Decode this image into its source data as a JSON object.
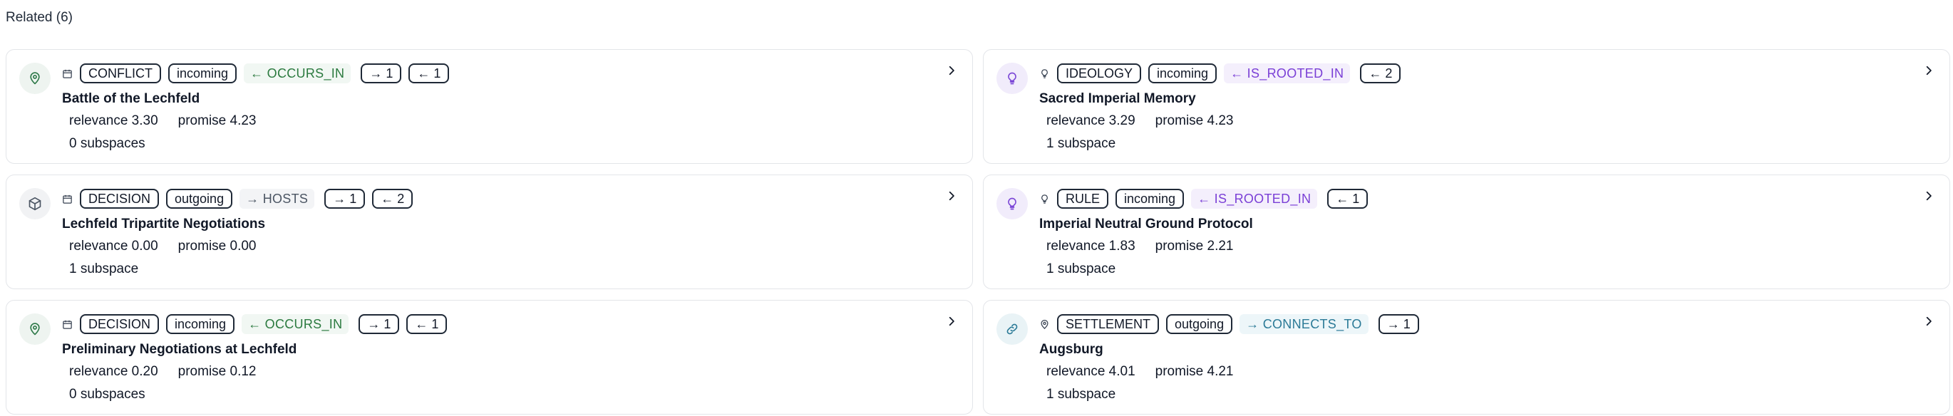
{
  "section": {
    "title": "Related (6)"
  },
  "cards": [
    {
      "avatar_icon": "map-pin-icon",
      "type_icon": "calendar-icon",
      "type": "CONFLICT",
      "direction": "incoming",
      "relation": "← OCCURS_IN",
      "relation_color": "green",
      "counts": [
        "→ 1",
        "← 1"
      ],
      "title": "Battle of the Lechfeld",
      "relevance": "relevance 3.30",
      "promise": "promise 4.23",
      "subspaces": "0 subspaces"
    },
    {
      "avatar_icon": "lightbulb-icon",
      "type_icon": "lightbulb-icon",
      "type": "IDEOLOGY",
      "direction": "incoming",
      "relation": "← IS_ROOTED_IN",
      "relation_color": "purple",
      "counts": [
        "← 2"
      ],
      "title": "Sacred Imperial Memory",
      "relevance": "relevance 3.29",
      "promise": "promise 4.23",
      "subspaces": "1 subspace"
    },
    {
      "avatar_icon": "cube-icon",
      "type_icon": "calendar-icon",
      "type": "DECISION",
      "direction": "outgoing",
      "relation": "→ HOSTS",
      "relation_color": "gray",
      "counts": [
        "→ 1",
        "← 2"
      ],
      "title": "Lechfeld Tripartite Negotiations",
      "relevance": "relevance 0.00",
      "promise": "promise 0.00",
      "subspaces": "1 subspace"
    },
    {
      "avatar_icon": "lightbulb-icon",
      "type_icon": "lightbulb-icon",
      "type": "RULE",
      "direction": "incoming",
      "relation": "← IS_ROOTED_IN",
      "relation_color": "purple",
      "counts": [
        "← 1"
      ],
      "title": "Imperial Neutral Ground Protocol",
      "relevance": "relevance 1.83",
      "promise": "promise 2.21",
      "subspaces": "1 subspace"
    },
    {
      "avatar_icon": "map-pin-icon",
      "type_icon": "calendar-icon",
      "type": "DECISION",
      "direction": "incoming",
      "relation": "← OCCURS_IN",
      "relation_color": "green",
      "counts": [
        "→ 1",
        "← 1"
      ],
      "title": "Preliminary Negotiations at Lechfeld",
      "relevance": "relevance 0.20",
      "promise": "promise 0.12",
      "subspaces": "0 subspaces"
    },
    {
      "avatar_icon": "link-icon",
      "type_icon": "map-pin-icon",
      "type": "SETTLEMENT",
      "direction": "outgoing",
      "relation": "→ CONNECTS_TO",
      "relation_color": "blue",
      "counts": [
        "→ 1"
      ],
      "title": "Augsburg",
      "relevance": "relevance 4.01",
      "promise": "promise 4.21",
      "subspaces": "1 subspace"
    }
  ],
  "colors": {
    "green": "#2b7a3f",
    "purple": "#7a3fd6",
    "gray": "#4b5563",
    "blue": "#2b7a97",
    "border": "#e3e5e9"
  }
}
